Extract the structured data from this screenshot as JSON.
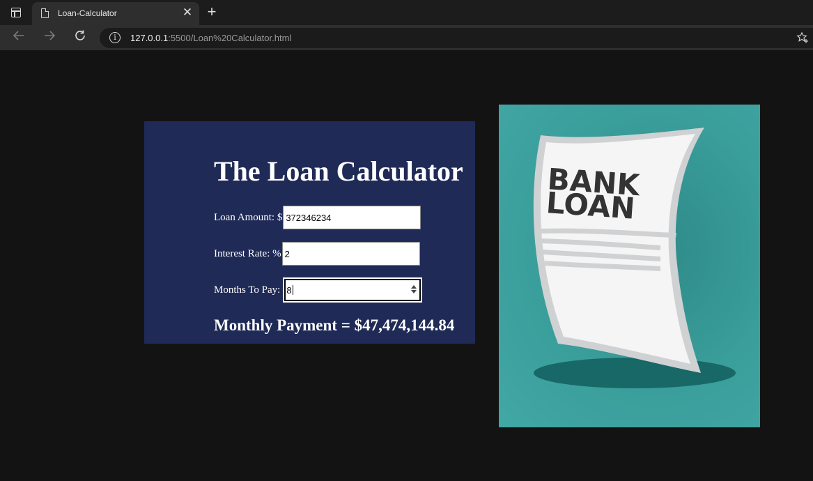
{
  "browser": {
    "tab_title": "Loan-Calculator",
    "tab_close": "✕",
    "new_tab": "+",
    "url_host": "127.0.0.1",
    "url_rest": ":5500/Loan%20Calculator.html",
    "icons": {
      "back": "back-arrow-icon",
      "forward": "forward-arrow-icon",
      "reload": "reload-icon",
      "info": "info-icon",
      "favorite": "add-favorite-icon"
    }
  },
  "calculator": {
    "title": "The Loan Calculator",
    "loan_amount_label": "Loan Amount: $",
    "loan_amount_value": "372346234",
    "interest_rate_label": "Interest Rate: %",
    "interest_rate_value": "2",
    "months_label": "Months To Pay:",
    "months_value": "8",
    "result": "Monthly Payment = $47,474,144.84"
  },
  "illustration": {
    "line1": "BANK",
    "line2": "LOAN"
  },
  "colors": {
    "panel_bg": "#1f2a56",
    "page_bg": "#131313",
    "teal_bg": "#3a9e9b",
    "paper": "#f5f5f5",
    "paper_shadow": "#cfd1d3",
    "ground_shadow": "#176866",
    "ink": "#333333"
  }
}
